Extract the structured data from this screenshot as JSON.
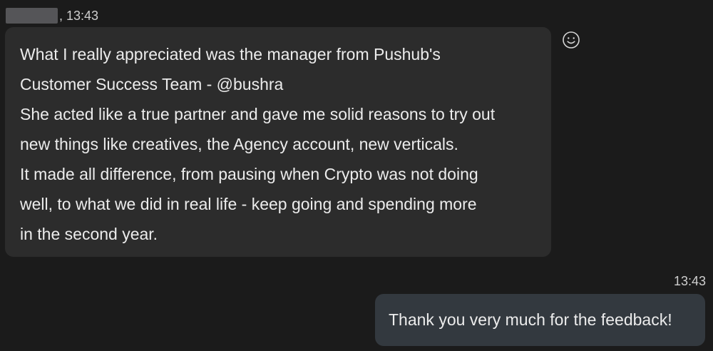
{
  "incoming": {
    "time": ", 13:43",
    "lines": [
      "What I really appreciated was the manager from Pushub's",
      "Customer Success Team - @bushra",
      "She acted like a true partner and gave me solid reasons to try out",
      "new things like creatives, the Agency account, new verticals.",
      "It made all difference, from pausing when Crypto was not doing",
      "well, to what we did in real life - keep going and spending more",
      "in the second year."
    ],
    "reaction_icon": "smiley-icon"
  },
  "outgoing": {
    "time": "13:43",
    "text": "Thank you very much for the feedback!"
  },
  "colors": {
    "background": "#1b1b1b",
    "incoming_bubble": "#2c2c2c",
    "outgoing_bubble": "#33393f",
    "text": "#ececec",
    "meta_text": "#cfcfcf"
  }
}
